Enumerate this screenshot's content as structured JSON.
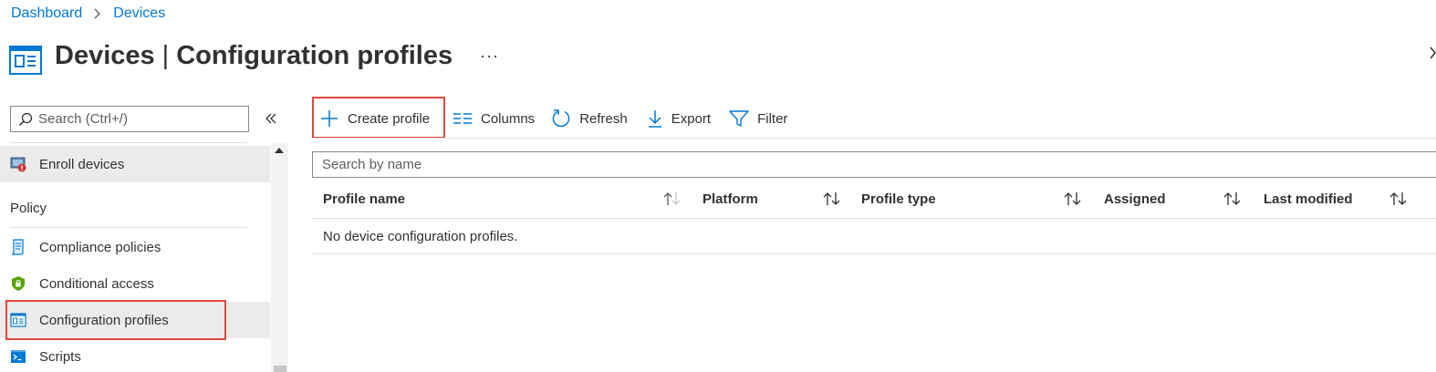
{
  "breadcrumb": {
    "items": [
      "Dashboard",
      "Devices"
    ]
  },
  "header": {
    "title_bold": "Devices",
    "title_separator": "|",
    "title_rest": "Configuration profiles",
    "more_label": "···"
  },
  "sidebar": {
    "search_placeholder": "Search (Ctrl+/)",
    "collapse_icon": "double-chevron-left-icon",
    "items": [
      {
        "label": "Enroll devices",
        "icon": "enroll-devices-icon"
      },
      {
        "label": "Compliance policies",
        "icon": "compliance-policies-icon"
      },
      {
        "label": "Conditional access",
        "icon": "conditional-access-shield-icon"
      },
      {
        "label": "Configuration profiles",
        "icon": "configuration-profiles-icon",
        "selected": true
      },
      {
        "label": "Scripts",
        "icon": "scripts-icon"
      }
    ],
    "section_policy": "Policy"
  },
  "toolbar": {
    "create_profile": "Create profile",
    "columns": "Columns",
    "refresh": "Refresh",
    "export": "Export",
    "filter": "Filter"
  },
  "search": {
    "placeholder": "Search by name"
  },
  "table": {
    "columns": [
      "Profile name",
      "Platform",
      "Profile type",
      "Assigned",
      "Last modified"
    ],
    "empty_message": "No device configuration profiles."
  },
  "colors": {
    "accent": "#0078d4",
    "highlight": "#e3463d",
    "selected_bg": "#edebe9"
  }
}
